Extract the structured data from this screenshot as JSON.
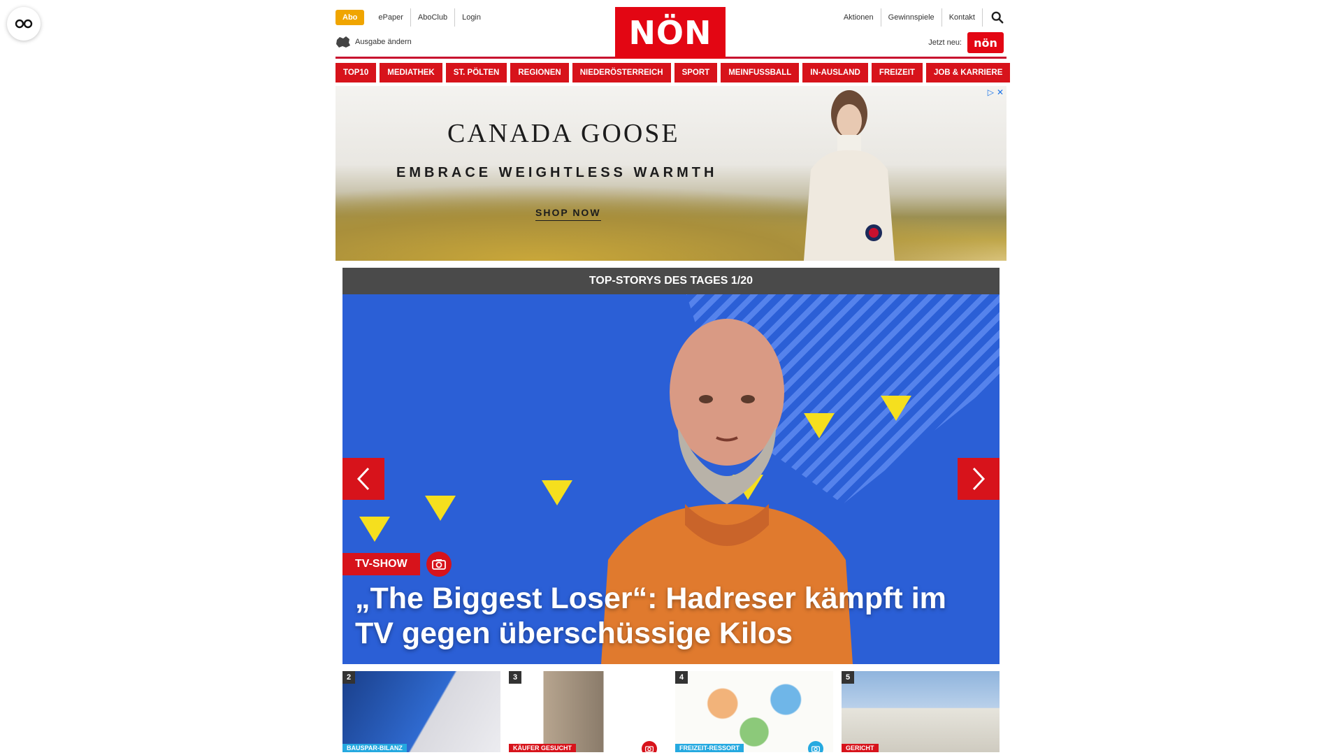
{
  "header": {
    "abo_label": "Abo",
    "top_links_left": [
      "ePaper",
      "AboClub",
      "Login"
    ],
    "edition_label": "Ausgabe ändern",
    "logo_text": "NÖN",
    "top_links_right": [
      "Aktionen",
      "Gewinnspiele",
      "Kontakt"
    ],
    "jetzt_label": "Jetzt neu:",
    "jetzt_badge": "nön"
  },
  "nav": {
    "items": [
      "TOP10",
      "MEDIATHEK",
      "ST. PÖLTEN",
      "REGIONEN",
      "NIEDERÖSTERREICH",
      "SPORT",
      "MEINFUSSBALL",
      "IN-AUSLAND",
      "FREIZEIT",
      "JOB & KARRIERE"
    ]
  },
  "ad": {
    "brand": "CANADA GOOSE",
    "tagline": "EMBRACE WEIGHTLESS WARMTH",
    "cta": "SHOP NOW"
  },
  "stories": {
    "header": "TOP-STORYS DES TAGES 1/20",
    "hero": {
      "category": "TV-SHOW",
      "title": "„The Biggest Loser“: Hadreser kämpft im TV gegen überschüssige Kilos"
    },
    "thumbs": [
      {
        "num": "2",
        "category": "BAUSPAR-BILANZ"
      },
      {
        "num": "3",
        "category": "KÄUFER GESUCHT"
      },
      {
        "num": "4",
        "category": "FREIZEIT-RESSORT"
      },
      {
        "num": "5",
        "category": "GERICHT"
      }
    ]
  },
  "colors": {
    "brand_red": "#d7131b",
    "abo_orange": "#f0a500",
    "stories_header": "#4a4a4a"
  }
}
